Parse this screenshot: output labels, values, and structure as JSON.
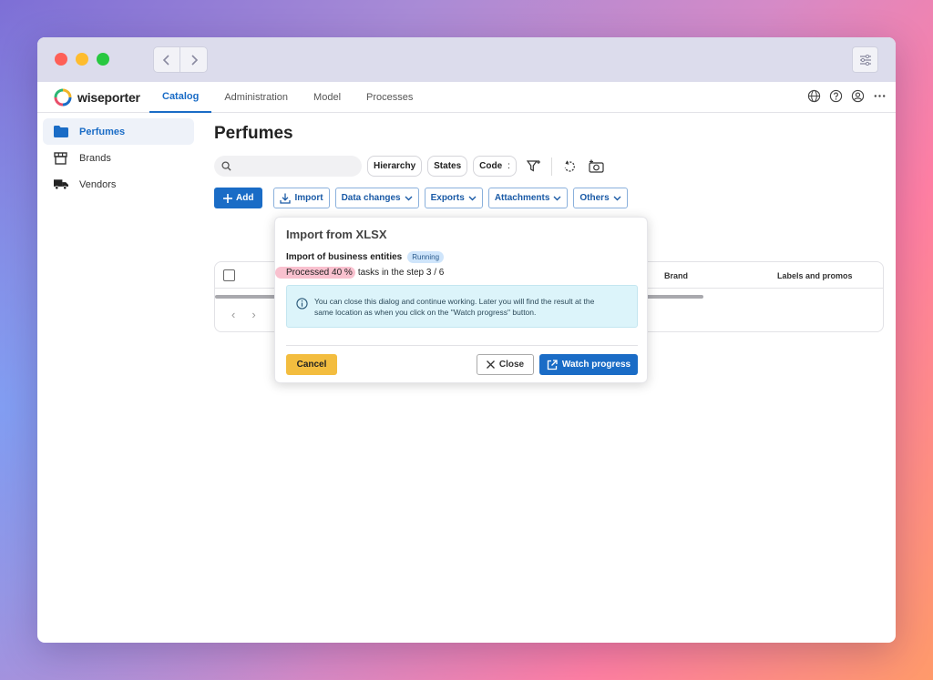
{
  "app": {
    "name": "wiseporter"
  },
  "colors": {
    "accent": "#1a6cc6",
    "cancel": "#f3bd3f",
    "info_bg": "#dcf4fa",
    "highlight": "#f9c1cf"
  },
  "tabs": [
    {
      "label": "Catalog",
      "active": true
    },
    {
      "label": "Administration"
    },
    {
      "label": "Model"
    },
    {
      "label": "Processes"
    }
  ],
  "header_icons": [
    "globe-icon",
    "help-icon",
    "user-icon",
    "more-icon"
  ],
  "sidebar": {
    "items": [
      {
        "label": "Perfumes",
        "icon": "folder-icon",
        "active": true
      },
      {
        "label": "Brands",
        "icon": "store-icon"
      },
      {
        "label": "Vendors",
        "icon": "truck-icon"
      }
    ]
  },
  "main": {
    "title": "Perfumes",
    "search": {
      "placeholder": "",
      "value": ""
    },
    "filters": [
      "Hierarchy",
      "States",
      "Code"
    ],
    "code_suffix": ":",
    "actions": {
      "add": "Add",
      "import": "Import",
      "data_changes": "Data changes",
      "exports": "Exports",
      "attachments": "Attachments",
      "others": "Others"
    },
    "table": {
      "columns": {
        "brand": "Brand",
        "labels": "Labels and promos"
      }
    }
  },
  "dialog": {
    "title": "Import from XLSX",
    "subtitle": "Import of business entities",
    "status": "Running",
    "progress_highlight": "Processed 40 %",
    "progress_rest": "tasks in the step 3 / 6",
    "progress_percent": 40,
    "info_line1": "You can close this dialog and continue working. Later you will find the result at the",
    "info_line2": "same location as when you click on the \"Watch progress\" button.",
    "cancel": "Cancel",
    "close": "Close",
    "watch": "Watch progress"
  }
}
